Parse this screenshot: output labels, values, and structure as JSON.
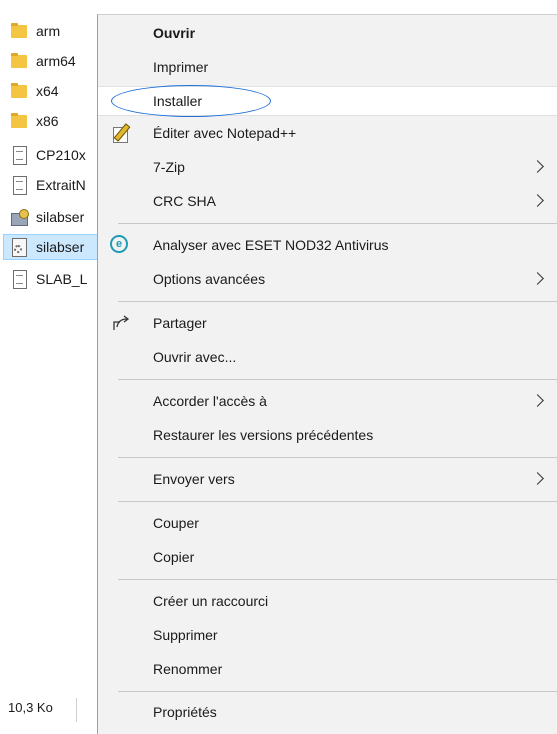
{
  "files": [
    {
      "name": "arm",
      "icon": "folder-icon"
    },
    {
      "name": "arm64",
      "icon": "folder-icon"
    },
    {
      "name": "x64",
      "icon": "folder-icon"
    },
    {
      "name": "x86",
      "icon": "folder-icon"
    },
    {
      "name": "CP210x",
      "icon": "document-icon"
    },
    {
      "name": "ExtraitN",
      "icon": "document-icon"
    },
    {
      "name": "silabser",
      "icon": "installer-icon"
    },
    {
      "name": "silabser",
      "icon": "settings-file-icon",
      "selected": true
    },
    {
      "name": "SLAB_L",
      "icon": "document-icon"
    }
  ],
  "status": {
    "size": "10,3 Ko"
  },
  "context_menu": {
    "items": {
      "open": "Ouvrir",
      "print": "Imprimer",
      "install": "Installer",
      "edit_notepad": "Éditer avec Notepad++",
      "zip": "7-Zip",
      "crc": "CRC SHA",
      "eset_scan": "Analyser avec ESET NOD32 Antivirus",
      "advanced": "Options avancées",
      "share": "Partager",
      "open_with": "Ouvrir avec...",
      "give_access": "Accorder l'accès à",
      "restore": "Restaurer les versions précédentes",
      "send_to": "Envoyer vers",
      "cut": "Couper",
      "copy": "Copier",
      "create_shortcut": "Créer un raccourci",
      "delete": "Supprimer",
      "rename": "Renommer",
      "properties": "Propriétés"
    },
    "highlight_color": "#1e6fd9"
  }
}
